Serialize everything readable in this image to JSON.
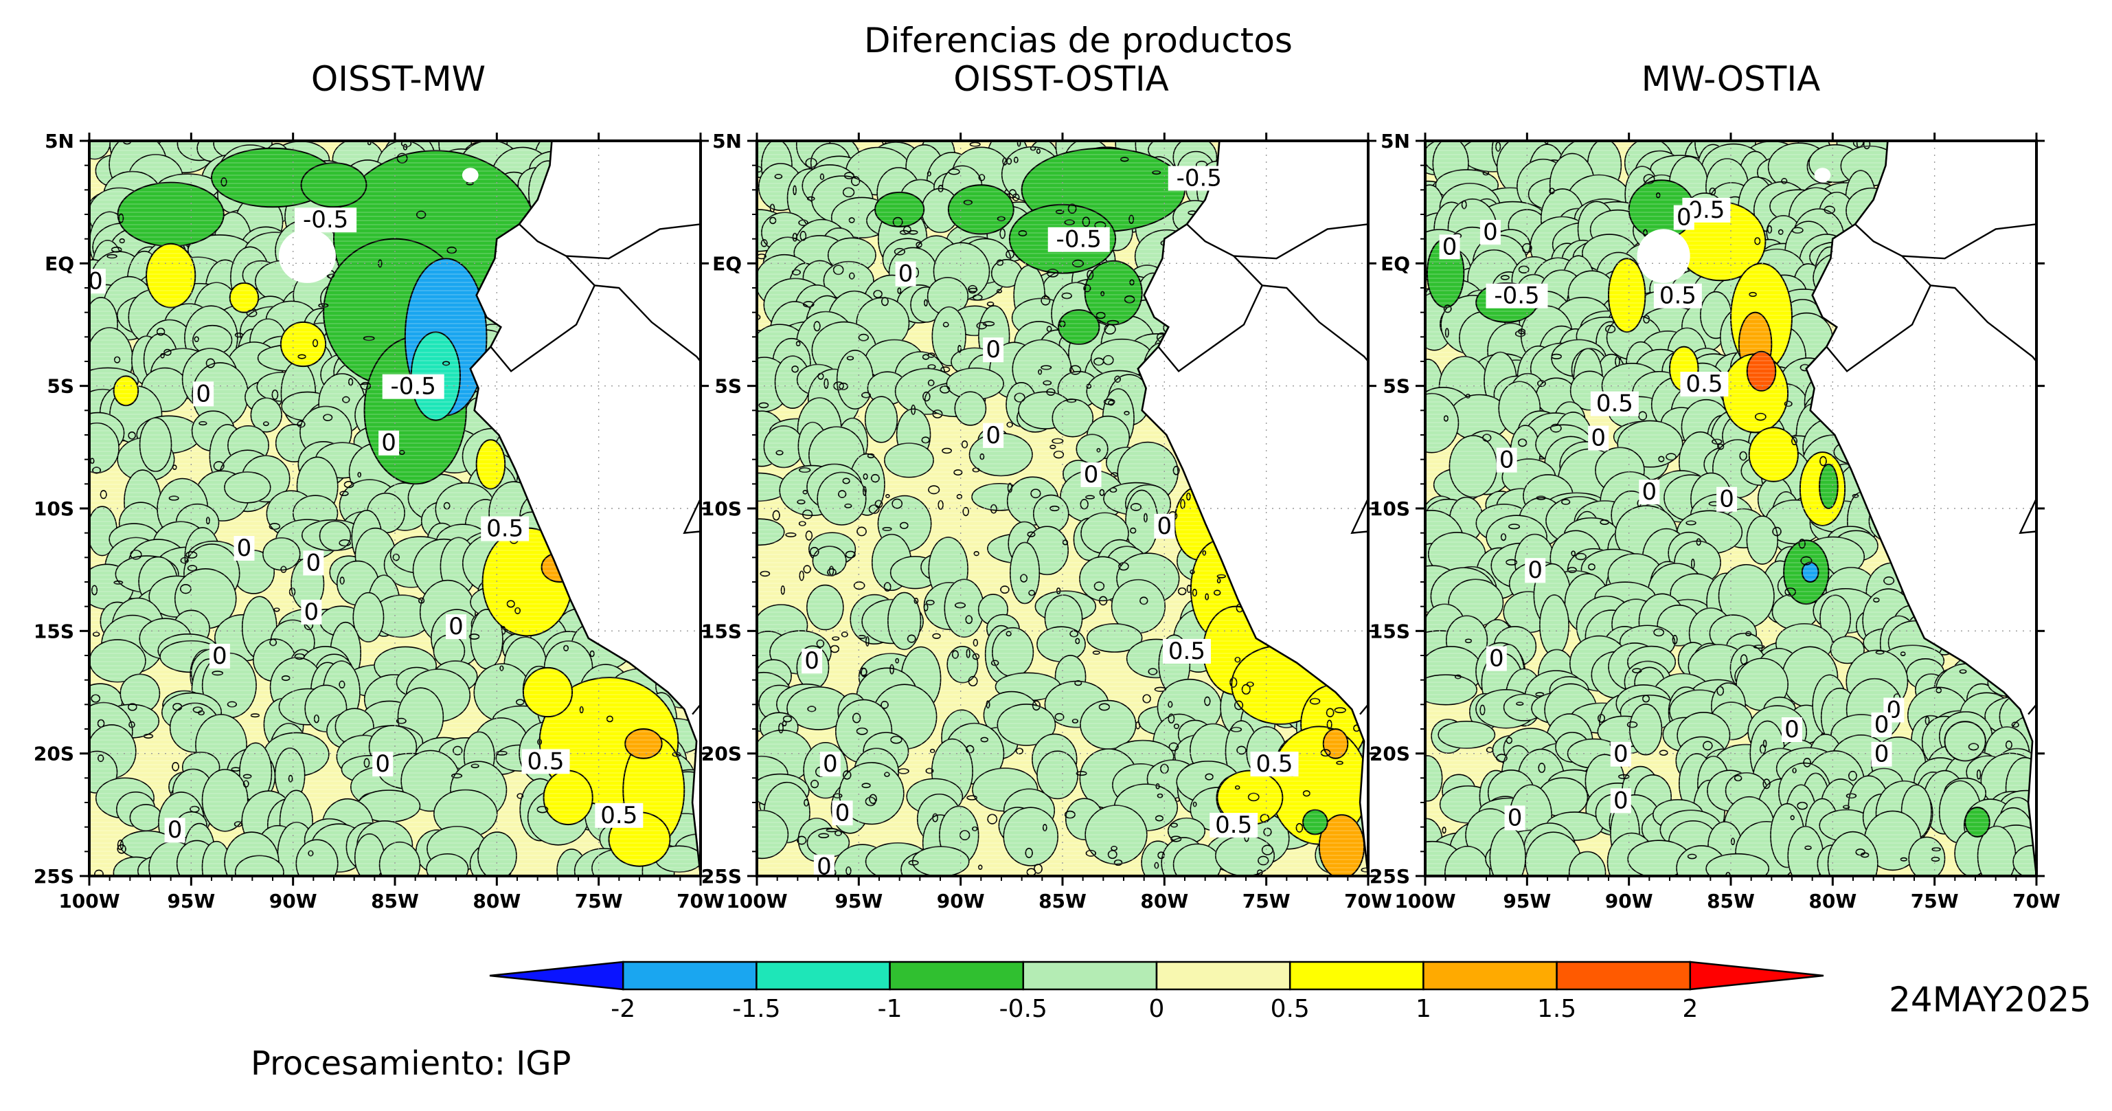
{
  "figure": {
    "suptitle": "Diferencias de productos",
    "date": "24MAY2025",
    "credit": "Procesamiento: IGP"
  },
  "map": {
    "lon_range": [
      -100,
      -70
    ],
    "lat_range": [
      -25,
      5
    ],
    "x_ticks": [
      "100W",
      "95W",
      "90W",
      "85W",
      "80W",
      "75W",
      "70W"
    ],
    "y_ticks": [
      "5N",
      "EQ",
      "5S",
      "10S",
      "15S",
      "20S",
      "25S"
    ],
    "grid": "dotted"
  },
  "panels": [
    {
      "title": "OISST-MW",
      "contour_labels": [
        {
          "text": "-0.5",
          "lon": -88.4,
          "lat": 1.8
        },
        {
          "text": "-0.5",
          "lon": -84.1,
          "lat": -5.0
        },
        {
          "text": "0",
          "lon": -99.7,
          "lat": -0.7
        },
        {
          "text": "0",
          "lon": -94.4,
          "lat": -5.3
        },
        {
          "text": "0",
          "lon": -92.4,
          "lat": -11.6
        },
        {
          "text": "0",
          "lon": -89.0,
          "lat": -12.2
        },
        {
          "text": "0",
          "lon": -89.1,
          "lat": -14.2
        },
        {
          "text": "0",
          "lon": -85.3,
          "lat": -7.3
        },
        {
          "text": "0",
          "lon": -82.0,
          "lat": -14.8
        },
        {
          "text": "0",
          "lon": -93.6,
          "lat": -16.0
        },
        {
          "text": "0",
          "lon": -85.6,
          "lat": -20.4
        },
        {
          "text": "0",
          "lon": -95.8,
          "lat": -23.1
        },
        {
          "text": "0.5",
          "lon": -79.6,
          "lat": -10.8
        },
        {
          "text": "0.5",
          "lon": -77.6,
          "lat": -20.3
        },
        {
          "text": "0.5",
          "lon": -74.0,
          "lat": -22.5
        }
      ]
    },
    {
      "title": "OISST-OSTIA",
      "contour_labels": [
        {
          "text": "-0.5",
          "lon": -78.3,
          "lat": 3.5
        },
        {
          "text": "-0.5",
          "lon": -84.2,
          "lat": 1.0
        },
        {
          "text": "0",
          "lon": -92.7,
          "lat": -0.4
        },
        {
          "text": "0",
          "lon": -88.4,
          "lat": -3.5
        },
        {
          "text": "0",
          "lon": -88.4,
          "lat": -7.0
        },
        {
          "text": "0",
          "lon": -83.6,
          "lat": -8.6
        },
        {
          "text": "0",
          "lon": -80.0,
          "lat": -10.7
        },
        {
          "text": "0",
          "lon": -97.3,
          "lat": -16.2
        },
        {
          "text": "0",
          "lon": -96.4,
          "lat": -20.4
        },
        {
          "text": "0",
          "lon": -95.8,
          "lat": -22.4
        },
        {
          "text": "0",
          "lon": -96.7,
          "lat": -24.6
        },
        {
          "text": "0.5",
          "lon": -78.9,
          "lat": -15.8
        },
        {
          "text": "0.5",
          "lon": -74.6,
          "lat": -20.4
        },
        {
          "text": "0.5",
          "lon": -76.6,
          "lat": -22.9
        }
      ]
    },
    {
      "title": "MW-OSTIA",
      "contour_labels": [
        {
          "text": "0",
          "lon": -98.8,
          "lat": 0.7
        },
        {
          "text": "0",
          "lon": -96.8,
          "lat": 1.3
        },
        {
          "text": "0.5",
          "lon": -86.2,
          "lat": 2.2
        },
        {
          "text": "0",
          "lon": -87.3,
          "lat": 1.9
        },
        {
          "text": "-0.5",
          "lon": -95.5,
          "lat": -1.3
        },
        {
          "text": "0.5",
          "lon": -87.6,
          "lat": -1.3
        },
        {
          "text": "0.5",
          "lon": -86.3,
          "lat": -4.9
        },
        {
          "text": "0.5",
          "lon": -90.7,
          "lat": -5.7
        },
        {
          "text": "0",
          "lon": -91.5,
          "lat": -7.1
        },
        {
          "text": "0",
          "lon": -96.0,
          "lat": -8.0
        },
        {
          "text": "0",
          "lon": -89.0,
          "lat": -9.3
        },
        {
          "text": "0",
          "lon": -85.2,
          "lat": -9.6
        },
        {
          "text": "0",
          "lon": -94.6,
          "lat": -12.5
        },
        {
          "text": "0",
          "lon": -96.5,
          "lat": -16.1
        },
        {
          "text": "0",
          "lon": -77.0,
          "lat": -18.2
        },
        {
          "text": "0",
          "lon": -77.6,
          "lat": -18.8
        },
        {
          "text": "0",
          "lon": -82.0,
          "lat": -19.0
        },
        {
          "text": "0",
          "lon": -90.4,
          "lat": -20.0
        },
        {
          "text": "0",
          "lon": -77.6,
          "lat": -20.0
        },
        {
          "text": "0",
          "lon": -90.4,
          "lat": -21.9
        },
        {
          "text": "0",
          "lon": -95.6,
          "lat": -22.6
        }
      ]
    }
  ],
  "colorbar": {
    "labels": [
      "-2",
      "-1.5",
      "-1",
      "-0.5",
      "0",
      "0.5",
      "1",
      "1.5",
      "2"
    ],
    "colors": [
      "#0a14ff",
      "#1aa6f0",
      "#1ee6b8",
      "#30c030",
      "#b4ecb4",
      "#f8f8b0",
      "#ffff00",
      "#ffaa00",
      "#ff5a00",
      "#ff0000"
    ]
  }
}
